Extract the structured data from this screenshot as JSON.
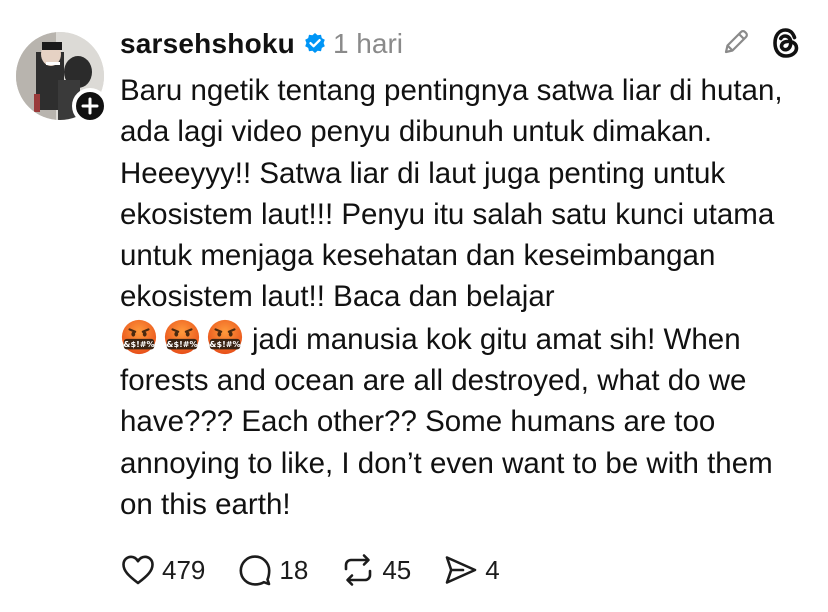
{
  "post": {
    "username": "sarsehshoku",
    "timestamp": "1 hari",
    "text_part1": "Baru ngetik tentang pentingnya satwa liar di hutan, ada lagi video penyu dibunuh untuk dimakan. Heeeyyy!! Satwa liar di laut juga penting untuk ekosistem laut!!! Penyu itu salah satu kunci utama untuk menjaga kesehatan dan keseimbangan ekosistem laut!! Baca dan belajar",
    "emojis": [
      "face-with-symbols-on-mouth",
      "face-with-symbols-on-mouth",
      "face-with-symbols-on-mouth"
    ],
    "emoji_symbol_text": "&$!#%",
    "text_part2": "jadi manusia kok gitu amat sih! When forests and ocean are all destroyed, what do we have??? Each other?? Some humans are too annoying to like, I don’t even want to be with them on this earth!"
  },
  "actions": {
    "likes": "479",
    "replies": "18",
    "reposts": "45",
    "shares": "4"
  },
  "icons": {
    "verified": "verified-badge-icon",
    "edit": "pencil-icon",
    "logo": "threads-logo",
    "like": "heart-icon",
    "reply": "comment-icon",
    "repost": "repost-icon",
    "share": "send-icon",
    "follow": "plus-icon"
  },
  "colors": {
    "verified": "#0095f6",
    "text": "#111111",
    "muted": "#8a8a8a",
    "emoji_face": "#f0661f"
  }
}
